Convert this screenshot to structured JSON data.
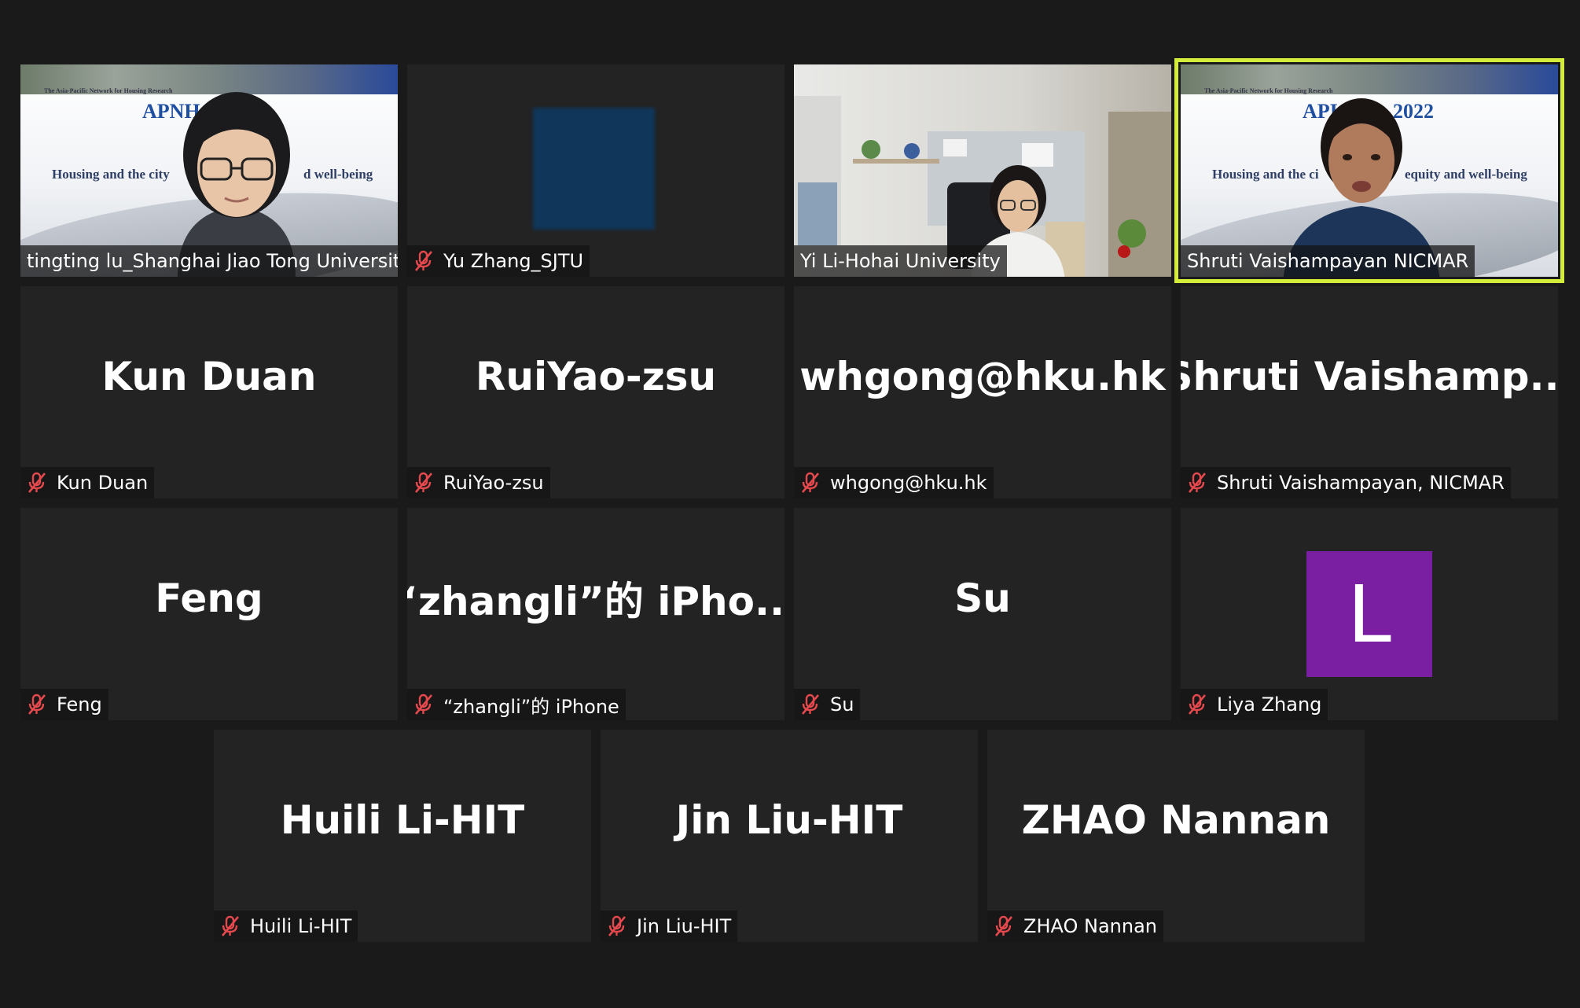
{
  "colors": {
    "background": "#1a1a1a",
    "tile": "#232323",
    "active_speaker_border": "#d4ec3a",
    "muted_icon": "#e5484d",
    "avatar": "#7b1fa2"
  },
  "participants": [
    {
      "name": "tingting lu_Shanghai Jiao Tong University",
      "display": "",
      "video": "banner-woman-glasses",
      "muted": false,
      "active": false,
      "banner": {
        "caption": "The Asia-Pacific Network for Housing Research",
        "title": "APNH",
        "subtitle_left": "Housing and the city",
        "subtitle_right": "d well-being"
      }
    },
    {
      "name": "Yu Zhang_SJTU",
      "display": "",
      "video": "blurred-blue",
      "muted": true,
      "active": false
    },
    {
      "name": "Yi Li-Hohai University",
      "display": "",
      "video": "office-room",
      "muted": false,
      "active": false
    },
    {
      "name": "Shruti Vaishampayan NICMAR",
      "display": "",
      "video": "banner-speaker",
      "muted": false,
      "active": true,
      "banner": {
        "caption": "The Asia-Pacific Network for Housing Research",
        "title": "API",
        "title_right": "2022",
        "subtitle_left": "Housing and the ci",
        "subtitle_right": "equity and well-being"
      }
    },
    {
      "name": "Kun Duan",
      "display": "Kun Duan",
      "video": "none",
      "muted": true,
      "active": false
    },
    {
      "name": "RuiYao-zsu",
      "display": "RuiYao-zsu",
      "video": "none",
      "muted": true,
      "active": false
    },
    {
      "name": "whgong@hku.hk",
      "display": "whgong@hku.hk",
      "video": "none",
      "muted": true,
      "active": false
    },
    {
      "name": "Shruti Vaishampayan, NICMAR",
      "display": "Shruti  Vaishamp...",
      "video": "none",
      "muted": true,
      "active": false
    },
    {
      "name": "Feng",
      "display": "Feng",
      "video": "none",
      "muted": true,
      "active": false
    },
    {
      "name": "“zhangli”的 iPhone",
      "display": "“zhangli”的 iPho...",
      "video": "none",
      "muted": true,
      "active": false
    },
    {
      "name": "Su",
      "display": "Su",
      "video": "none",
      "muted": true,
      "active": false
    },
    {
      "name": "Liya Zhang",
      "display": "",
      "video": "avatar",
      "avatar_letter": "L",
      "muted": true,
      "active": false
    },
    {
      "name": "Huili Li-HIT",
      "display": "Huili Li-HIT",
      "video": "none",
      "muted": true,
      "active": false
    },
    {
      "name": "Jin Liu-HIT",
      "display": "Jin Liu-HIT",
      "video": "none",
      "muted": true,
      "active": false
    },
    {
      "name": "ZHAO Nannan",
      "display": "ZHAO Nannan",
      "video": "none",
      "muted": true,
      "active": false
    }
  ]
}
